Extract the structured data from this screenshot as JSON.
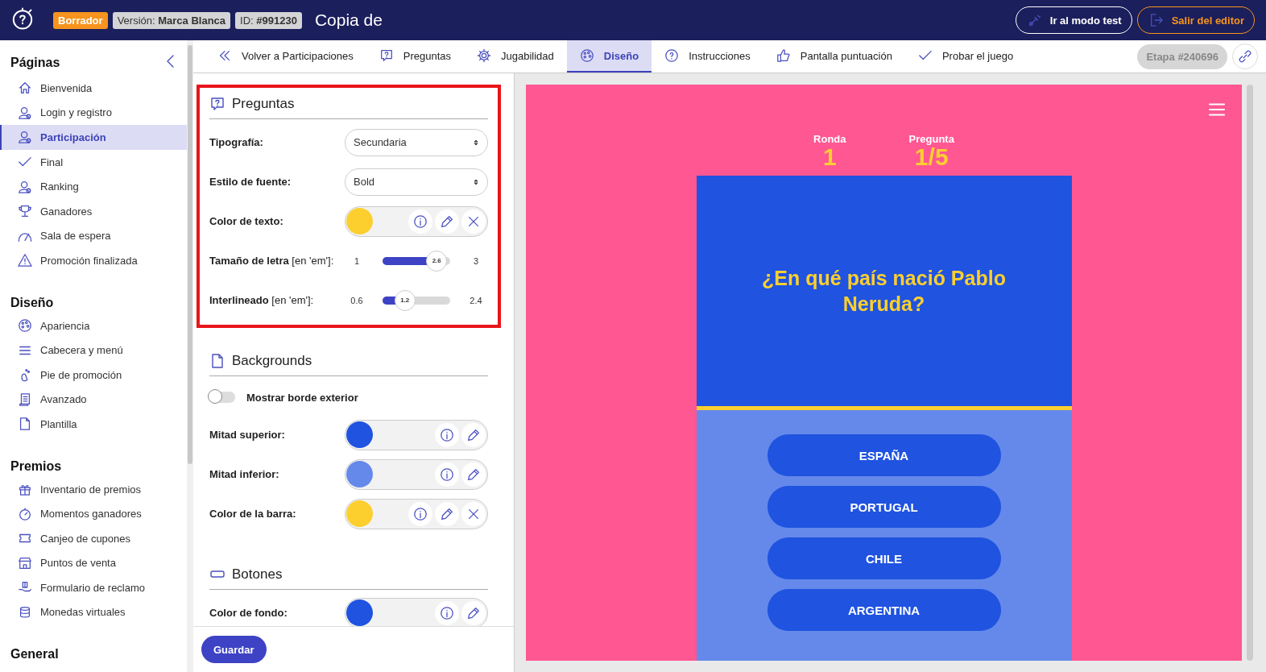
{
  "topbar": {
    "badges": [
      {
        "text": "Borrador",
        "kind": "status"
      },
      {
        "text": "Versión: **Marca Blanca**",
        "kind": "info"
      },
      {
        "text": "ID: **#991230**",
        "kind": "info"
      }
    ],
    "title": "Copia de",
    "buttons": [
      {
        "label": "Ir al modo test",
        "kind": "light"
      },
      {
        "label": "Salir del editor",
        "kind": "exit"
      }
    ]
  },
  "sidebar": {
    "sections": [
      {
        "title": "Páginas",
        "collapsible": true,
        "items": [
          {
            "label": "Bienvenida",
            "selected": false
          },
          {
            "label": "Login y registro",
            "selected": false
          },
          {
            "label": "Participación",
            "selected": true
          },
          {
            "label": "Final",
            "selected": false
          },
          {
            "label": "Ranking",
            "selected": false
          },
          {
            "label": "Ganadores",
            "selected": false
          },
          {
            "label": "Sala de espera",
            "selected": false
          },
          {
            "label": "Promoción finalizada",
            "selected": false
          }
        ]
      },
      {
        "title": "Diseño",
        "items": [
          {
            "label": "Apariencia",
            "selected": false
          },
          {
            "label": "Cabecera y menú",
            "selected": false
          },
          {
            "label": "Pie de promoción",
            "selected": false
          },
          {
            "label": "Avanzado",
            "selected": false
          },
          {
            "label": "Plantilla",
            "selected": false
          }
        ]
      },
      {
        "title": "Premios",
        "items": [
          {
            "label": "Inventario de premios",
            "selected": false
          },
          {
            "label": "Momentos ganadores",
            "selected": false
          },
          {
            "label": "Canjeo de cupones",
            "selected": false
          },
          {
            "label": "Puntos de venta",
            "selected": false
          },
          {
            "label": "Formulario de reclamo",
            "selected": false
          },
          {
            "label": "Monedas virtuales",
            "selected": false
          }
        ]
      },
      {
        "title": "General"
      }
    ]
  },
  "tabs": [
    {
      "label": "Volver a Participaciones",
      "selected": false
    },
    {
      "label": "Preguntas",
      "selected": false
    },
    {
      "label": "Jugabilidad",
      "selected": false
    },
    {
      "label": "Diseño",
      "selected": true
    },
    {
      "label": "Instrucciones",
      "selected": false
    },
    {
      "label": "Pantalla puntuación",
      "selected": false
    },
    {
      "label": "Probar el juego",
      "selected": false
    }
  ],
  "stage": "Etapa #240696",
  "panel": {
    "sections": [
      {
        "title": "Preguntas",
        "highlighted": true,
        "rows": [
          {
            "kind": "select",
            "label": "Tipografía:",
            "value": "Secundaria"
          },
          {
            "kind": "select",
            "label": "Estilo de fuente:",
            "value": "Bold"
          },
          {
            "kind": "color",
            "label": "Color de texto:",
            "color": "#fccf2f",
            "clearable": true
          },
          {
            "kind": "slider",
            "label": "**Tamaño de letra** [en 'em']:",
            "min": "1",
            "max": "3",
            "value": "2.6",
            "level": 0.8
          },
          {
            "kind": "slider",
            "label": "**Interlineado** [en 'em']:",
            "min": "0.6",
            "max": "2.4",
            "value": "1.2",
            "level": 0.33
          }
        ]
      },
      {
        "title": "Backgrounds",
        "highlighted": false,
        "rows": [
          {
            "kind": "toggle",
            "label": "Mostrar borde exterior",
            "on": false
          },
          {
            "kind": "color",
            "label": "Mitad superior:",
            "color": "#1f53e0",
            "clearable": false
          },
          {
            "kind": "color",
            "label": "Mitad inferior:",
            "color": "#6589ea",
            "clearable": false
          },
          {
            "kind": "color",
            "label": "Color de la barra:",
            "color": "#fccf2f",
            "clearable": true
          }
        ]
      },
      {
        "title": "Botones",
        "highlighted": false,
        "rows": [
          {
            "kind": "color",
            "label": "Color de fondo:",
            "color": "#1f53e0",
            "clearable": false
          }
        ]
      }
    ],
    "save": "Guardar"
  },
  "preview": {
    "stats": [
      {
        "label": "Ronda",
        "value": "1"
      },
      {
        "label": "Pregunta",
        "value": "1/5"
      }
    ],
    "question": "¿En qué país nació Pablo Neruda?",
    "answers": [
      "ESPAÑA",
      "PORTUGAL",
      "CHILE",
      "ARGENTINA"
    ]
  }
}
